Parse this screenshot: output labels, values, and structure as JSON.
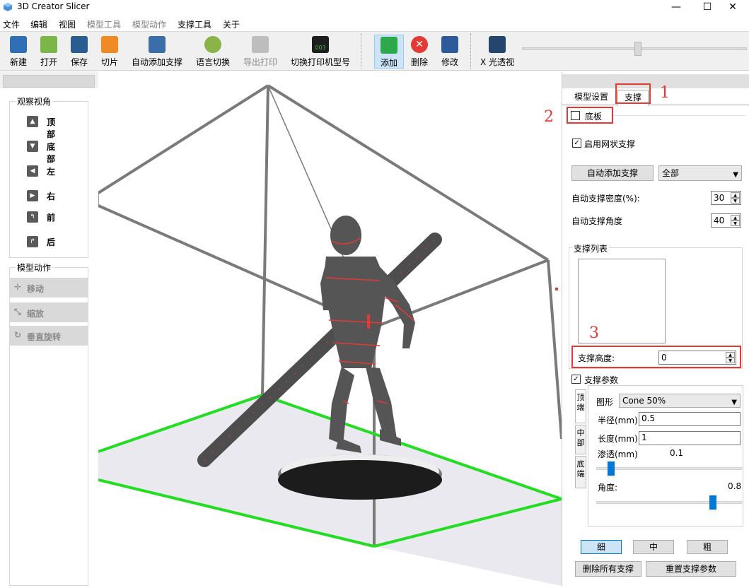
{
  "window": {
    "title": "3D Creator Slicer",
    "minimize": "—",
    "maximize": "☐",
    "close": "✕"
  },
  "menu": [
    "文件",
    "编辑",
    "视图",
    "模型工具",
    "模型动作",
    "支撑工具",
    "关于"
  ],
  "toolbar": {
    "new": "新建",
    "open": "打开",
    "save": "保存",
    "slice": "切片",
    "auto_support": "自动添加支撑",
    "language": "语言切换",
    "export_print": "导出打印",
    "switch_printer": "切换打印机型号",
    "printer_code": "003",
    "add": "添加",
    "delete": "删除",
    "edit": "修改",
    "xray": "X 光透视"
  },
  "left": {
    "view_group": "观察视角",
    "views": [
      "顶部",
      "底部",
      "左",
      "右",
      "前",
      "后"
    ],
    "action_group": "模型动作",
    "actions": [
      "移动",
      "缩放",
      "垂直旋转"
    ]
  },
  "right": {
    "tabs": [
      "模型设置",
      "支撑"
    ],
    "baseplate": "底板",
    "grid_support": "启用网状支撑",
    "auto_add_support": "自动添加支撑",
    "scope": "全部",
    "density_label": "自动支撑密度(%):",
    "density_value": "30",
    "angle_label": "自动支撑角度",
    "angle_value": "40",
    "support_list": "支撑列表",
    "height_label": "支撑高度:",
    "height_value": "0",
    "params": "支撑参数",
    "vtabs": [
      "顶端",
      "中部",
      "底端"
    ],
    "shape_label": "图形",
    "shape_value": "Cone 50%",
    "radius_label": "半径(mm)",
    "radius_value": "0.5",
    "length_label": "长度(mm)",
    "length_value": "1",
    "penetration_label": "渗透(mm)",
    "penetration_value": "0.1",
    "penetration_level": 0.1,
    "angle2_label": "角度:",
    "angle2_value": "0.8",
    "angle2_level": 0.8,
    "thin": "细",
    "medium": "中",
    "thick": "粗",
    "delete_all": "删除所有支撑",
    "reset_params": "重置支撑参数"
  },
  "annotations": [
    "1",
    "2",
    "3"
  ],
  "colors": {
    "build_plate_edge": "#22dd22",
    "model": "#555555",
    "highlight": "#e53935",
    "accent": "#0078d7"
  }
}
